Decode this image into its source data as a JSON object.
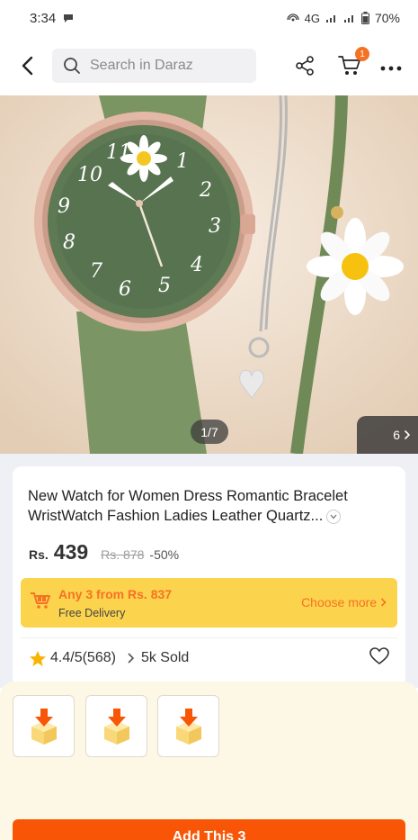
{
  "status_bar": {
    "time": "3:34",
    "network": "4G",
    "battery": "70%"
  },
  "top_bar": {
    "search_placeholder": "Search in Daraz",
    "cart_count": "1"
  },
  "gallery": {
    "counter": "1/7",
    "more_count": "6"
  },
  "product": {
    "title_line1": "New Watch for Women Dress Romantic Bracelet",
    "title_line2": "WristWatch Fashion Ladies Leather Quartz...",
    "currency": "Rs.",
    "price": "439",
    "original_price": "Rs. 878",
    "discount": "-50%"
  },
  "promo": {
    "title": "Any 3 from Rs. 837",
    "subtitle": "Free Delivery",
    "link": "Choose more"
  },
  "rating": {
    "score": "4.4/5",
    "count": "(568)",
    "sold": "5k Sold"
  },
  "bundle": {
    "add_button": "Add This 3"
  },
  "colors": {
    "accent": "#f57224",
    "promo_bg": "#fcd34d",
    "cta": "#f85606"
  }
}
